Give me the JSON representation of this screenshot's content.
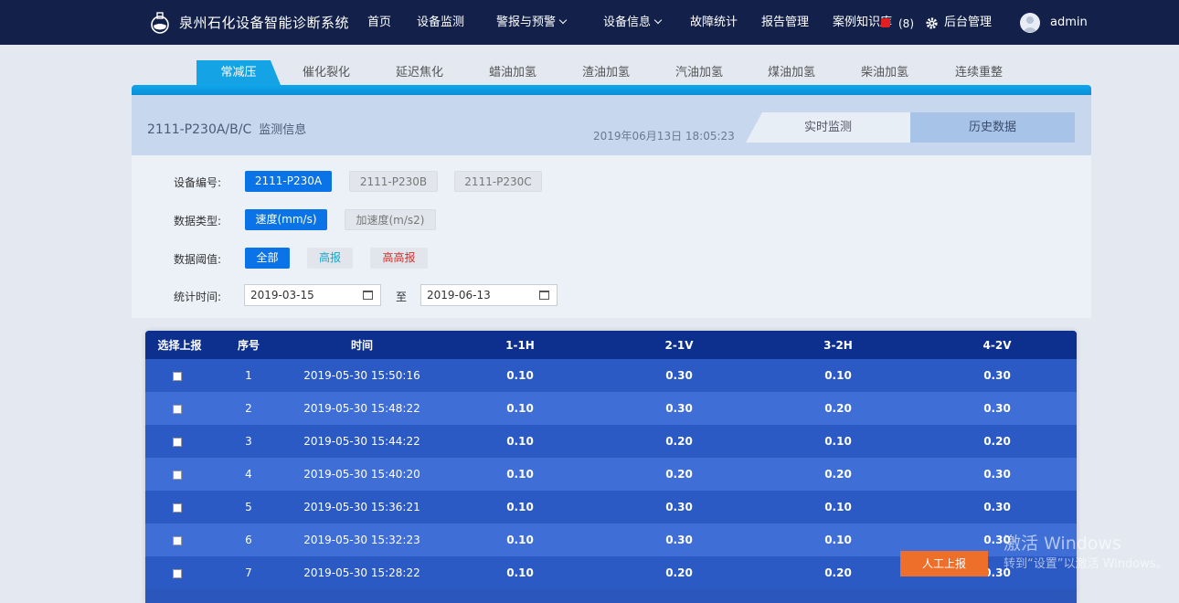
{
  "nav": {
    "title": "泉州石化设备智能诊断系统",
    "items": [
      "首页",
      "设备监测",
      "警报与预警",
      "设备信息",
      "故障统计",
      "报告管理",
      "案例知识库"
    ],
    "count": "(8)",
    "admin_label": "后台管理",
    "user": "admin"
  },
  "tabs": [
    "常减压",
    "催化裂化",
    "延迟焦化",
    "蜡油加氢",
    "渣油加氢",
    "汽油加氢",
    "煤油加氢",
    "柴油加氢",
    "连续重整"
  ],
  "panel": {
    "device": "2111-P230A/B/C",
    "subtitle": "监测信息",
    "timestamp": "2019年06月13日 18:05:23",
    "seg_realtime": "实时监测",
    "seg_history": "历史数据"
  },
  "filters": {
    "device_label": "设备编号:",
    "devices": [
      "2111-P230A",
      "2111-P230B",
      "2111-P230C"
    ],
    "type_label": "数据类型:",
    "types": [
      "速度(mm/s)",
      "加速度(m/s2)"
    ],
    "threshold_label": "数据阈值:",
    "thresholds": [
      "全部",
      "高报",
      "高高报"
    ],
    "range_label": "统计时间:",
    "from": "2019-03-15",
    "to_word": "至",
    "to": "2019-06-13"
  },
  "table": {
    "headers": [
      "选择上报",
      "序号",
      "时间",
      "1-1H",
      "2-1V",
      "3-2H",
      "4-2V"
    ],
    "rows": [
      [
        "1",
        "2019-05-30 15:50:16",
        "0.10",
        "0.30",
        "0.10",
        "0.30"
      ],
      [
        "2",
        "2019-05-30 15:48:22",
        "0.10",
        "0.30",
        "0.20",
        "0.30"
      ],
      [
        "3",
        "2019-05-30 15:44:22",
        "0.10",
        "0.20",
        "0.10",
        "0.20"
      ],
      [
        "4",
        "2019-05-30 15:40:20",
        "0.10",
        "0.20",
        "0.20",
        "0.30"
      ],
      [
        "5",
        "2019-05-30 15:36:21",
        "0.10",
        "0.30",
        "0.10",
        "0.30"
      ],
      [
        "6",
        "2019-05-30 15:32:23",
        "0.10",
        "0.30",
        "0.10",
        "0.30"
      ],
      [
        "7",
        "2019-05-30 15:28:22",
        "0.10",
        "0.20",
        "0.20",
        "0.30"
      ]
    ]
  },
  "report_button": "人工上报",
  "watermark": {
    "line1": "激活 Windows",
    "line2": "转到“设置”以激活 Windows。"
  }
}
